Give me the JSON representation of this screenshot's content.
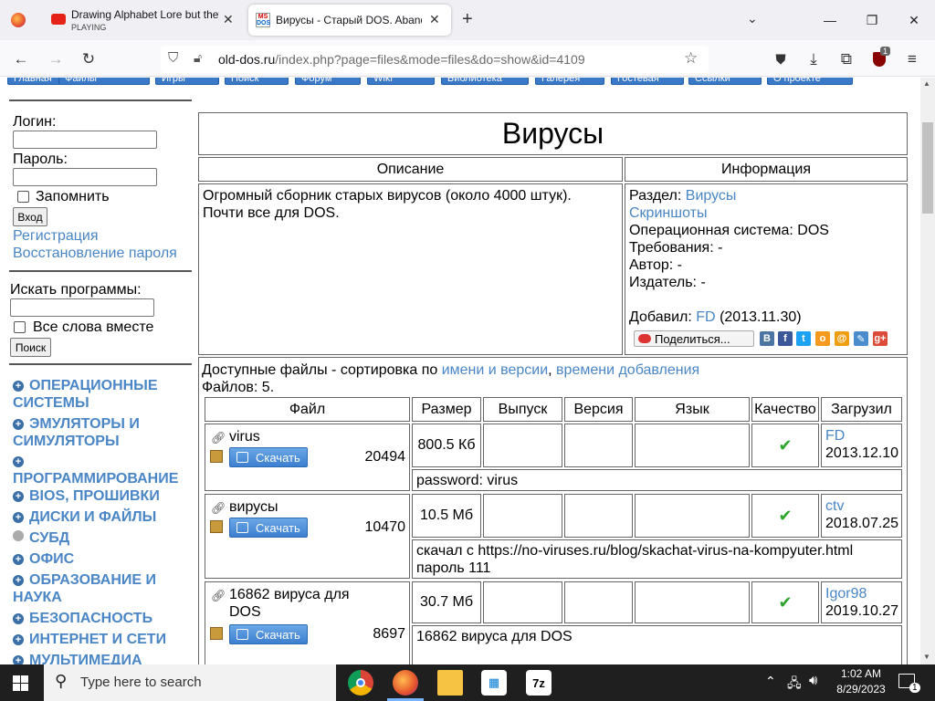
{
  "browser": {
    "tabs": [
      {
        "title": "Drawing Alphabet Lore but they",
        "status": "PLAYING"
      },
      {
        "title": "Вирусы - Старый DOS. Aband"
      }
    ],
    "url_host": "old-dos.ru",
    "url_path": "/index.php?page=files&mode=files&do=show&id=4109",
    "extension_badge": "1"
  },
  "topnav": [
    "Главная",
    "Файлы",
    "Игры",
    "Поиск",
    "Форум",
    "Wiki",
    "Библиотека",
    "Галерея",
    "Гостевая",
    "Ссылки",
    "О проекте"
  ],
  "sidebar": {
    "login_label": "Логин:",
    "password_label": "Пароль:",
    "remember_label": "Запомнить",
    "login_button": "Вход",
    "register_link": "Регистрация",
    "recover_link": "Восстановление пароля",
    "search_label": "Искать программы:",
    "all_words_label": "Все слова вместе",
    "search_button": "Поиск",
    "categories": [
      {
        "label": "ОПЕРАЦИОННЫЕ СИСТЕМЫ",
        "bullet": "plus"
      },
      {
        "label": "ЭМУЛЯТОРЫ И СИМУЛЯТОРЫ",
        "bullet": "plus"
      },
      {
        "label": "ПРОГРАММИРОВАНИЕ",
        "bullet": "plus"
      },
      {
        "label": "BIOS, прошивки",
        "bullet": "plus"
      },
      {
        "label": "ДИСКИ И ФАЙЛЫ",
        "bullet": "plus"
      },
      {
        "label": "СУБД",
        "bullet": "dot"
      },
      {
        "label": "ОФИС",
        "bullet": "plus"
      },
      {
        "label": "ОБРАЗОВАНИЕ И НАУКА",
        "bullet": "plus"
      },
      {
        "label": "БЕЗОПАСНОСТЬ",
        "bullet": "plus"
      },
      {
        "label": "ИНТЕРНЕТ И СЕТИ",
        "bullet": "plus"
      },
      {
        "label": "МУЛЬТИМЕДИА",
        "bullet": "plus"
      }
    ]
  },
  "main": {
    "title": "Вирусы",
    "desc_header": "Описание",
    "info_header": "Информация",
    "description_line1": "Огромный сборник старых вирусов (около 4000 штук).",
    "description_line2": "Почти все для DOS.",
    "info": {
      "section_label": "Раздел:",
      "section_value": "Вирусы",
      "screenshots_link": "Скриншоты",
      "os_line": "Операционная система: DOS",
      "req_line": "Требования: -",
      "author_line": "Автор: -",
      "publisher_line": "Издатель: -",
      "added_label": "Добавил:",
      "added_user": "FD",
      "added_date": "(2013.11.30)",
      "share_button": "Поделиться..."
    },
    "files_sort_prefix": "Доступные файлы - сортировка по",
    "sort_by_name": "имени и версии",
    "sort_by_time": "времени добавления",
    "files_count": "Файлов: 5.",
    "columns": [
      "Файл",
      "Размер",
      "Выпуск",
      "Версия",
      "Язык",
      "Качество",
      "Загрузил"
    ],
    "download_label": "Скачать",
    "files": [
      {
        "name": "virus",
        "downloads": "20494",
        "size": "800.5 Кб",
        "uploader": "FD",
        "date": "2013.12.10",
        "note": "password: virus",
        "note2": ""
      },
      {
        "name": "вирусы",
        "downloads": "10470",
        "size": "10.5 Мб",
        "uploader": "ctv",
        "date": "2018.07.25",
        "note": "скачал с https://no-viruses.ru/blog/skachat-virus-na-kompyuter.html",
        "note2": "пароль 111"
      },
      {
        "name": "16862 вируса для DOS",
        "downloads": "8697",
        "size": "30.7 Мб",
        "uploader": "Igor98",
        "date": "2019.10.27",
        "note": "16862 вируса для DOS",
        "note2": ""
      }
    ]
  },
  "taskbar": {
    "search_placeholder": "Type here to search",
    "time": "1:02 AM",
    "date": "8/29/2023",
    "notification_count": "1"
  }
}
